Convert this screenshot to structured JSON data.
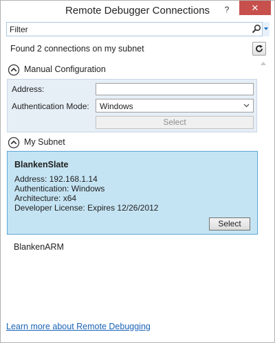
{
  "window": {
    "title": "Remote Debugger Connections",
    "help_label": "?",
    "close_label": "✕"
  },
  "filter": {
    "placeholder": "Filter",
    "search_icon": "search-icon"
  },
  "status": {
    "found_text": "Found 2 connections on my subnet",
    "refresh_icon": "refresh-icon"
  },
  "manual": {
    "header": "Manual Configuration",
    "address_label": "Address:",
    "address_value": "",
    "auth_label": "Authentication Mode:",
    "auth_value": "Windows",
    "select_label": "Select"
  },
  "subnet": {
    "header": "My Subnet",
    "connections": [
      {
        "name": "BlankenSlate",
        "address_label": "Address:",
        "address": "192.168.1.14",
        "auth_label": "Authentication:",
        "auth": "Windows",
        "arch_label": "Architecture:",
        "arch": "x64",
        "license_label": "Developer License:",
        "license": "Expires 12/26/2012",
        "select_label": "Select"
      },
      {
        "name": "BlankenARM"
      }
    ]
  },
  "footer": {
    "link_text": "Learn more about Remote Debugging"
  },
  "colors": {
    "accent": "#1b6fc2",
    "selected_bg": "#c5e4f3",
    "selected_border": "#5aa7d8",
    "manual_bg": "#e6eef6",
    "close_bg": "#c7504c",
    "link": "#1a62b6"
  }
}
